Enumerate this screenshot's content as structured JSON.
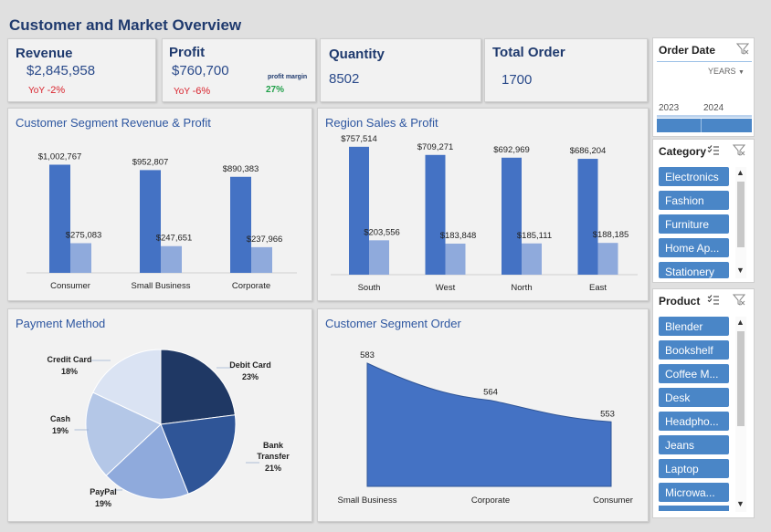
{
  "title": "Customer and Market Overview",
  "kpis": {
    "revenue": {
      "label": "Revenue",
      "value": "$2,845,958",
      "yoy_label": "YoY",
      "yoy": "-2%"
    },
    "profit": {
      "label": "Profit",
      "value": "$760,700",
      "yoy_label": "YoY",
      "yoy": "-6%",
      "margin_label": "profit margin",
      "margin": "27%"
    },
    "quantity": {
      "label": "Quantity",
      "value": "8502"
    },
    "orders": {
      "label": "Total Order",
      "value": "1700"
    }
  },
  "slicers": {
    "order_date": {
      "title": "Order Date",
      "level": "YEARS",
      "years": [
        "2023",
        "2024"
      ]
    },
    "category": {
      "title": "Category",
      "items": [
        "Electronics",
        "Fashion",
        "Furniture",
        "Home Ap...",
        "Stationery"
      ]
    },
    "product": {
      "title": "Product",
      "items": [
        "Blender",
        "Bookshelf",
        "Coffee M...",
        "Desk",
        "Headpho...",
        "Jeans",
        "Laptop",
        "Microwa..."
      ]
    }
  },
  "colors": {
    "revenue": "#4472c4",
    "profit": "#8faadc",
    "title": "#1f3a6e",
    "chip": "#4a86c7",
    "negative": "#d9232d",
    "positive": "#21a04a"
  },
  "chart_data": [
    {
      "type": "bar",
      "title": "Customer Segment Revenue & Profit",
      "categories": [
        "Consumer",
        "Small Business",
        "Corporate"
      ],
      "series": [
        {
          "values": [
            1002767,
            952807,
            890383
          ],
          "labels": [
            "$1,002,767",
            "$952,807",
            "$890,383"
          ]
        },
        {
          "values": [
            275083,
            247651,
            237966
          ],
          "labels": [
            "$275,083",
            "$247,651",
            "$237,966"
          ]
        }
      ],
      "ylim": [
        0,
        1100000
      ]
    },
    {
      "type": "bar",
      "title": "Region Sales & Profit",
      "categories": [
        "South",
        "West",
        "North",
        "East"
      ],
      "series": [
        {
          "values": [
            757514,
            709271,
            692969,
            686204
          ],
          "labels": [
            "$757,514",
            "$709,271",
            "$692,969",
            "$686,204"
          ]
        },
        {
          "values": [
            203556,
            183848,
            185111,
            188185
          ],
          "labels": [
            "$203,556",
            "$183,848",
            "$185,111",
            "$188,185"
          ]
        }
      ],
      "ylim": [
        0,
        800000
      ]
    },
    {
      "type": "pie",
      "title": "Payment Method",
      "slices": [
        {
          "name": "Debit Card",
          "value": 23,
          "label": "23%",
          "color": "#1f3864"
        },
        {
          "name": "Bank Transfer",
          "value": 21,
          "label": "21%",
          "color": "#2f5597"
        },
        {
          "name": "PayPal",
          "value": 19,
          "label": "19%",
          "color": "#8faadc"
        },
        {
          "name": "Cash",
          "value": 19,
          "label": "19%",
          "color": "#b4c7e7"
        },
        {
          "name": "Credit Card",
          "value": 18,
          "label": "18%",
          "color": "#dae3f3"
        }
      ]
    },
    {
      "type": "area",
      "title": "Customer Segment Order",
      "categories": [
        "Small Business",
        "Corporate",
        "Consumer"
      ],
      "values": [
        583,
        564,
        553
      ],
      "ylim": [
        520,
        590
      ]
    }
  ]
}
